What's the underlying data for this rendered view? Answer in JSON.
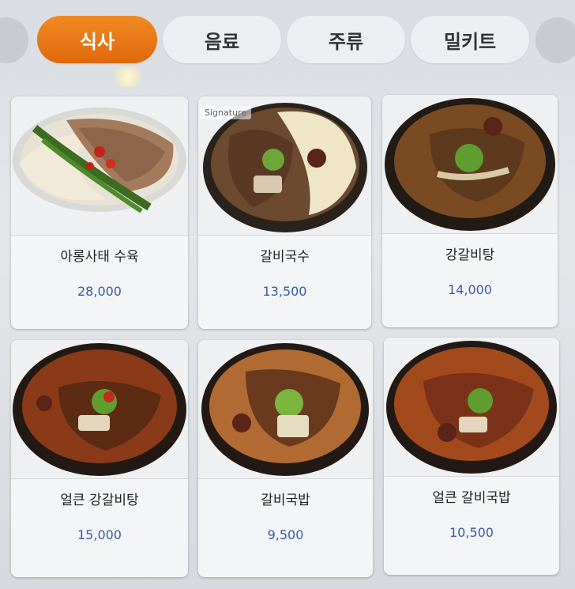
{
  "tabs": [
    {
      "label": "식사",
      "active": true
    },
    {
      "label": "음료",
      "active": false
    },
    {
      "label": "주류",
      "active": false
    },
    {
      "label": "밀키트",
      "active": false
    }
  ],
  "colors": {
    "active_tab": "#e8761a",
    "price": "#3a5aa8"
  },
  "menu": [
    {
      "name": "아롱사태 수육",
      "price": "28,000",
      "badge": ""
    },
    {
      "name": "갈비국수",
      "price": "13,500",
      "badge": "Signature"
    },
    {
      "name": "강갈비탕",
      "price": "14,000",
      "badge": ""
    },
    {
      "name": "얼큰 강갈비탕",
      "price": "15,000",
      "badge": ""
    },
    {
      "name": "갈비국밥",
      "price": "9,500",
      "badge": ""
    },
    {
      "name": "얼큰 갈비국밥",
      "price": "10,500",
      "badge": ""
    }
  ]
}
